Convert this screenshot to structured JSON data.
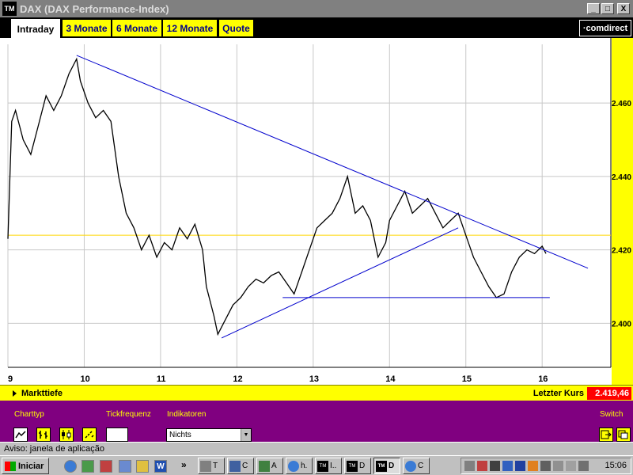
{
  "window": {
    "app_icon": "TM",
    "title": "DAX (DAX Performance-Index)",
    "controls": [
      "_",
      "□",
      "X"
    ]
  },
  "tabs": [
    {
      "label": "Intraday",
      "active": true
    },
    {
      "label": "3 Monate",
      "active": false
    },
    {
      "label": "6 Monate",
      "active": false
    },
    {
      "label": "12 Monate",
      "active": false
    },
    {
      "label": "Quote",
      "active": false
    }
  ],
  "brand": "·comdirect",
  "chart_data": {
    "type": "line",
    "x_ticks": [
      "9",
      "10",
      "11",
      "12",
      "13",
      "14",
      "15",
      "16"
    ],
    "y_ticks": [
      "2.400",
      "2.420",
      "2.440",
      "2.460"
    ],
    "ylim": [
      2388,
      2476
    ],
    "xlim": [
      9,
      16.9
    ],
    "reference_level": 2424,
    "series": [
      {
        "x": [
          9.0,
          9.05,
          9.1,
          9.2,
          9.3,
          9.4,
          9.5,
          9.6,
          9.7,
          9.8,
          9.9,
          9.95,
          10.05,
          10.15,
          10.25,
          10.35,
          10.45,
          10.55,
          10.65,
          10.75,
          10.85,
          10.95,
          11.05,
          11.15,
          11.25,
          11.35,
          11.45,
          11.55,
          11.6,
          11.7,
          11.75,
          11.85,
          11.95,
          12.05,
          12.15,
          12.25,
          12.35,
          12.45,
          12.55,
          12.65,
          12.75,
          12.85,
          12.95,
          13.05,
          13.15,
          13.25,
          13.35,
          13.45,
          13.55,
          13.65,
          13.75,
          13.85,
          13.95,
          14.0,
          14.1,
          14.2,
          14.3,
          14.4,
          14.5,
          14.6,
          14.7,
          14.8,
          14.9,
          15.0,
          15.1,
          15.2,
          15.3,
          15.4,
          15.5,
          15.6,
          15.7,
          15.8,
          15.9,
          16.0,
          16.05
        ],
        "values": [
          2423,
          2455,
          2458,
          2450,
          2446,
          2454,
          2462,
          2458,
          2462,
          2468,
          2472,
          2466,
          2460,
          2456,
          2458,
          2455,
          2440,
          2430,
          2426,
          2420,
          2424,
          2418,
          2422,
          2420,
          2426,
          2423,
          2427,
          2420,
          2410,
          2402,
          2397,
          2401,
          2405,
          2407,
          2410,
          2412,
          2411,
          2413,
          2414,
          2411,
          2408,
          2414,
          2420,
          2426,
          2428,
          2430,
          2434,
          2440,
          2430,
          2432,
          2428,
          2418,
          2422,
          2428,
          2432,
          2436,
          2430,
          2432,
          2434,
          2430,
          2426,
          2428,
          2430,
          2424,
          2418,
          2414,
          2410,
          2407,
          2408,
          2414,
          2418,
          2420,
          2419,
          2421,
          2419
        ]
      }
    ],
    "trendlines": [
      {
        "from": [
          9.9,
          2473
        ],
        "to": [
          16.6,
          2415
        ]
      },
      {
        "from": [
          11.8,
          2396
        ],
        "to": [
          14.9,
          2426
        ]
      },
      {
        "from": [
          12.6,
          2407
        ],
        "to": [
          16.1,
          2407
        ]
      }
    ],
    "lines_color": "#0000cd",
    "reference_color": "#ffd700",
    "grid": true
  },
  "infobar": {
    "markttiefe": "Markttiefe",
    "letzter_kurs_label": "Letzter Kurs",
    "letzter_kurs_value": "2.419,46"
  },
  "controls": {
    "charttyp_label": "Charttyp",
    "tickfrequenz_label": "Tickfrequenz",
    "indikatoren_label": "Indikatoren",
    "indikatoren_value": "Nichts",
    "switch_label": "Switch"
  },
  "status": "Aviso: janela de aplicação",
  "taskbar": {
    "start": "Iniciar",
    "more": "»",
    "tasks": [
      {
        "label": "T",
        "icon": "tool-icon"
      },
      {
        "label": "C",
        "icon": "app-icon"
      },
      {
        "label": "A",
        "icon": "app-icon"
      },
      {
        "label": "h.",
        "icon": "ie-icon"
      },
      {
        "label": "I..",
        "icon": "tm-icon"
      },
      {
        "label": "D",
        "icon": "tm-icon"
      },
      {
        "label": "D",
        "icon": "tm-icon",
        "active": true
      },
      {
        "label": "C",
        "icon": "ie-icon"
      }
    ],
    "clock": "15:06"
  }
}
